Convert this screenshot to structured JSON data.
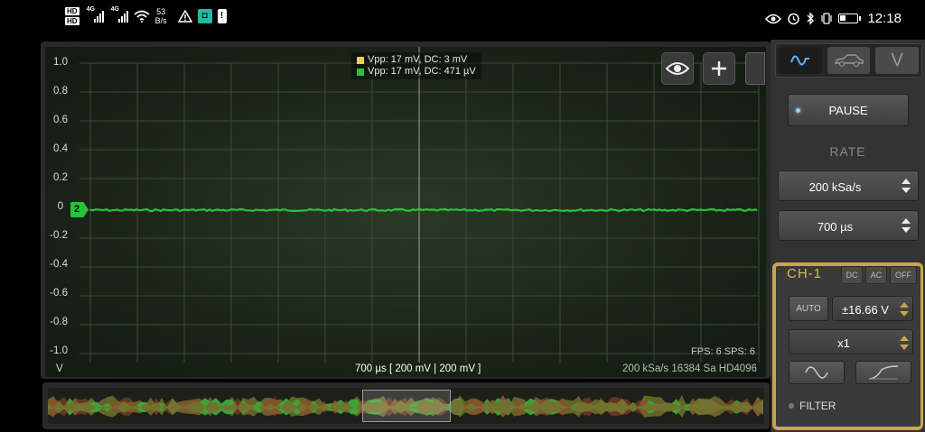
{
  "statusbar": {
    "hd_badges": [
      "HD",
      "HD"
    ],
    "signal_labels": [
      "4G",
      "4G"
    ],
    "net_speed_value": "53",
    "net_speed_unit": "B/s",
    "app_badge": "!",
    "time": "12:18"
  },
  "scope": {
    "y_labels": [
      "1.0",
      "0.8",
      "0.6",
      "0.4",
      "0.2",
      "0",
      "-0.2",
      "-0.4",
      "-0.6",
      "-0.8",
      "-1.0"
    ],
    "legend": [
      {
        "color": "#f2d13a",
        "text": "Vpp: 17 mV, DC: 3 mV"
      },
      {
        "color": "#27c23a",
        "text": "Vpp: 17 mV, DC: 471 µV"
      }
    ],
    "channel_marker": "2",
    "trace_color": "#27c23a",
    "fps_text": "FPS: 6  SPS: 6",
    "unit_label": "V",
    "timebase_text": "700 µs  [ 200 mV | 200 mV ]",
    "acq_info": "200 kSa/s   16384 Sa   HD4096"
  },
  "panel": {
    "tabs": [
      {
        "icon": "sine-wave-icon",
        "active": true
      },
      {
        "icon": "car-icon",
        "active": false
      },
      {
        "icon": "v-letter-icon",
        "label": "V",
        "active": false
      }
    ],
    "pause_label": "PAUSE",
    "rate_label": "RATE",
    "sample_rate": "200 kSa/s",
    "time_per_div": "700 µs",
    "channel": {
      "name": "CH-1",
      "coupling": [
        "DC",
        "AC",
        "OFF"
      ],
      "auto_label": "AUTO",
      "range": "±16.66 V",
      "probe": "x1",
      "filter_label": "FILTER"
    }
  }
}
